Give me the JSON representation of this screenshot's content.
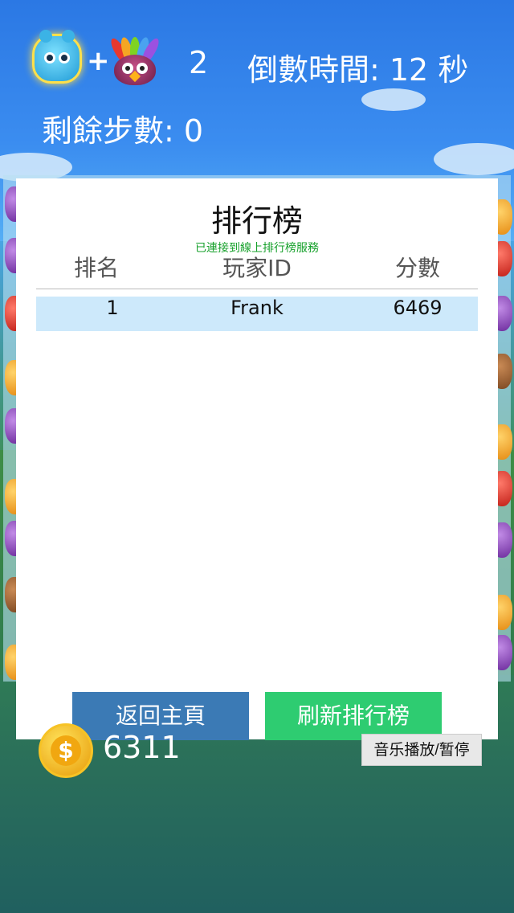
{
  "hud": {
    "combo_icons": [
      "blue-blob-icon",
      "rainbow-owl-icon"
    ],
    "plus_sign": "+",
    "combo_count": "2",
    "countdown_label": "倒數時間: 12 秒",
    "moves_label": "剩餘步數: 0"
  },
  "leaderboard": {
    "title": "排行榜",
    "status": "已連接到線上排行榜服務",
    "columns": [
      "排名",
      "玩家ID",
      "分數"
    ],
    "rows": [
      {
        "rank": "1",
        "player_id": "Frank",
        "score": "6469"
      }
    ],
    "back_label": "返回主頁",
    "refresh_label": "刷新排行榜"
  },
  "footer": {
    "coin_icon": "dollar-coin-icon",
    "coin_symbol": "$",
    "coin_count": "6311",
    "music_label": "音乐播放/暂停"
  },
  "colors": {
    "back_button": "#3b7ab5",
    "refresh_button": "#2ecc71",
    "status_text": "#15a02a",
    "row_highlight": "#cde9fb"
  }
}
